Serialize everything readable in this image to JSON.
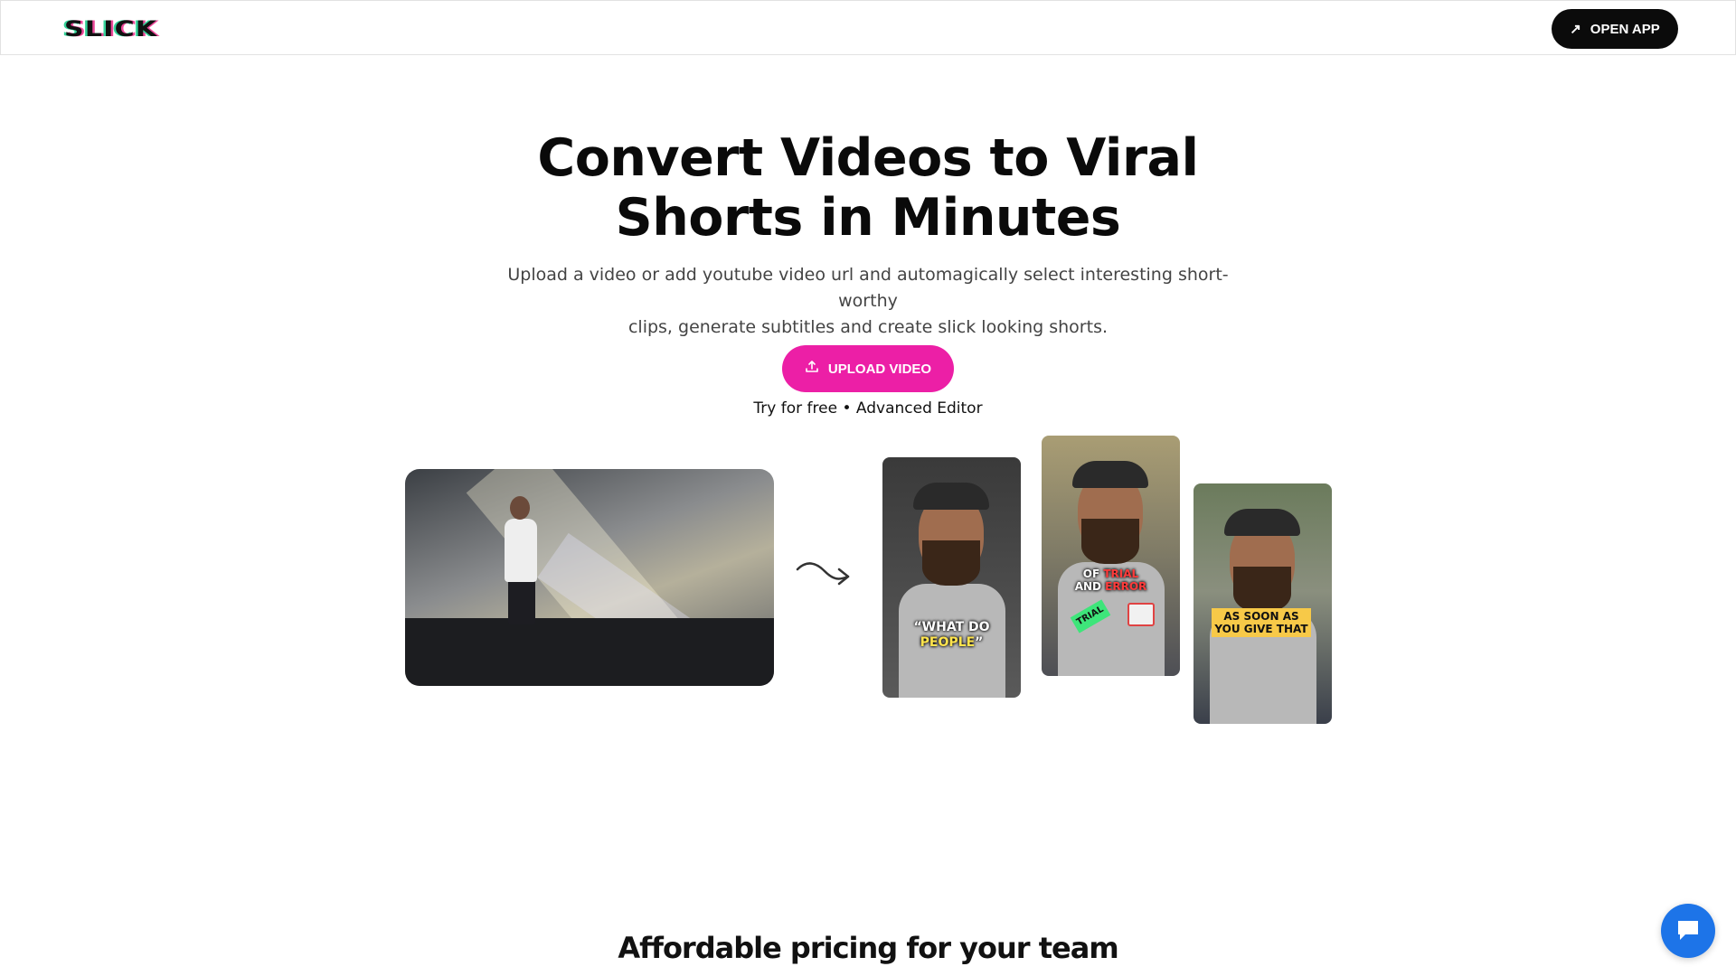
{
  "header": {
    "logo_text": "SLICK",
    "open_app_label": "OPEN APP",
    "open_app_icon": "arrow-up-right-icon"
  },
  "hero": {
    "title_line1": "Convert Videos to Viral",
    "title_line2": "Shorts in Minutes",
    "subtitle_line1": "Upload a video or add youtube video url and automagically select interesting short-worthy",
    "subtitle_line2": "clips, generate subtitles and create slick looking shorts.",
    "upload_label": "UPLOAD VIDEO",
    "upload_icon": "upload-icon",
    "try_free": "Try for free",
    "separator": " • ",
    "advanced_editor": "Advanced Editor"
  },
  "shorts": [
    {
      "caption_white": "“WHAT DO",
      "caption_highlight": "PEOPLE",
      "caption_end": "”"
    },
    {
      "caption_white_1": "OF",
      "caption_red_1": "TRIAL",
      "caption_white_2": "AND",
      "caption_red_2": "ERROR",
      "sticker": "TRIAL"
    },
    {
      "caption_line1": "AS SOON AS",
      "caption_line2": "YOU GIVE THAT"
    }
  ],
  "pricing": {
    "title": "Affordable pricing for your team"
  },
  "chat": {
    "icon": "chat-bubble-icon"
  },
  "colors": {
    "accent": "#ec1fa6",
    "dark_button": "#0b0b0b",
    "chat": "#1d74e8"
  }
}
